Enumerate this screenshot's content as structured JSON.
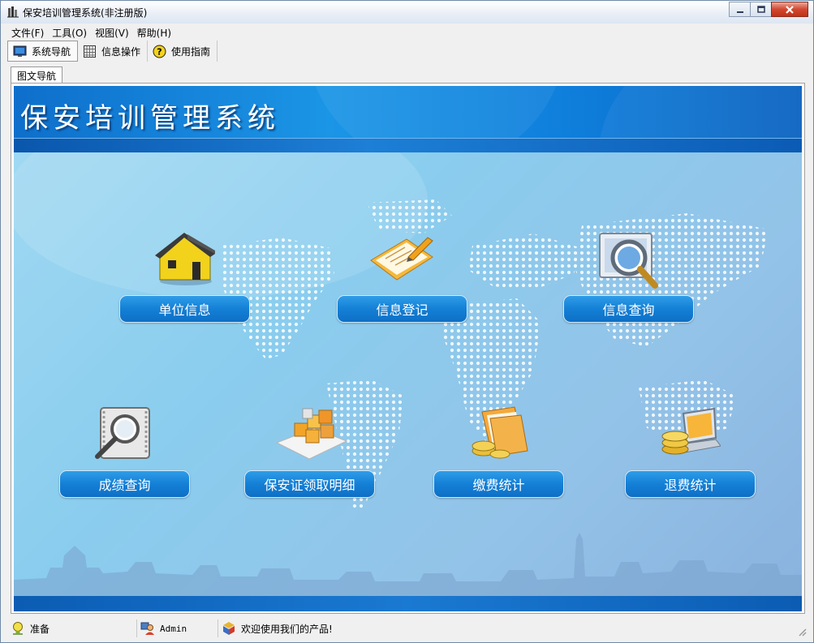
{
  "window": {
    "title": "保安培训管理系统(非注册版)"
  },
  "menu": {
    "items": [
      {
        "label": "文件(F)"
      },
      {
        "label": "工具(O)"
      },
      {
        "label": "视图(V)"
      },
      {
        "label": "帮助(H)"
      }
    ]
  },
  "toolbar": {
    "items": [
      {
        "label": "系统导航",
        "icon": "monitor-icon"
      },
      {
        "label": "信息操作",
        "icon": "grid-icon"
      },
      {
        "label": "使用指南",
        "icon": "help-icon"
      }
    ]
  },
  "tabs": [
    {
      "label": "图文导航"
    }
  ],
  "banner": {
    "title": "保安培训管理系统"
  },
  "features": [
    {
      "label": "单位信息",
      "icon": "house-icon"
    },
    {
      "label": "信息登记",
      "icon": "register-icon"
    },
    {
      "label": "信息查询",
      "icon": "magnifier-screen-icon"
    },
    {
      "label": "成绩查询",
      "icon": "magnifier-doc-icon"
    },
    {
      "label": "保安证领取明细",
      "icon": "boxes-icon"
    },
    {
      "label": "缴费统计",
      "icon": "folder-coins-icon"
    },
    {
      "label": "退费统计",
      "icon": "laptop-coins-icon"
    }
  ],
  "statusbar": {
    "ready": "准备",
    "user": "Admin",
    "welcome": "欢迎使用我们的产品!"
  },
  "colors": {
    "banner": "#1b95e6",
    "button": "#1480d6",
    "close_button": "#d2472f"
  }
}
